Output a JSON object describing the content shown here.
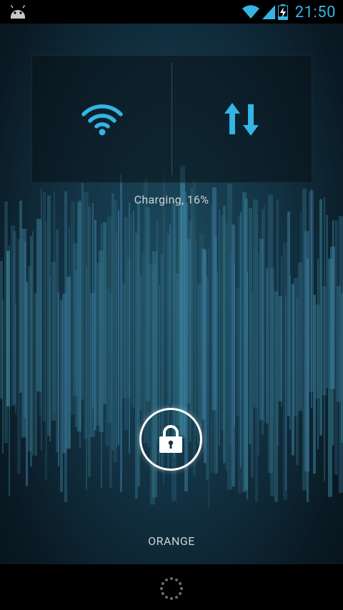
{
  "status_bar": {
    "time": "21:50",
    "icons": [
      "android-notification-icon",
      "wifi-signal-icon",
      "cell-signal-icon",
      "battery-charging-icon"
    ],
    "accent": "#35b5e5"
  },
  "widget": {
    "toggles": [
      {
        "name": "wifi-toggle",
        "icon": "wifi-icon",
        "color": "#33b5e5"
      },
      {
        "name": "data-toggle",
        "icon": "data-arrows-icon",
        "color": "#33b5e5"
      }
    ]
  },
  "battery": {
    "status_text": "Charging, 16%"
  },
  "lock": {
    "icon": "padlock-icon"
  },
  "carrier": {
    "name": "ORANGE"
  },
  "nav": {
    "icon": "loading-dots-icon"
  }
}
